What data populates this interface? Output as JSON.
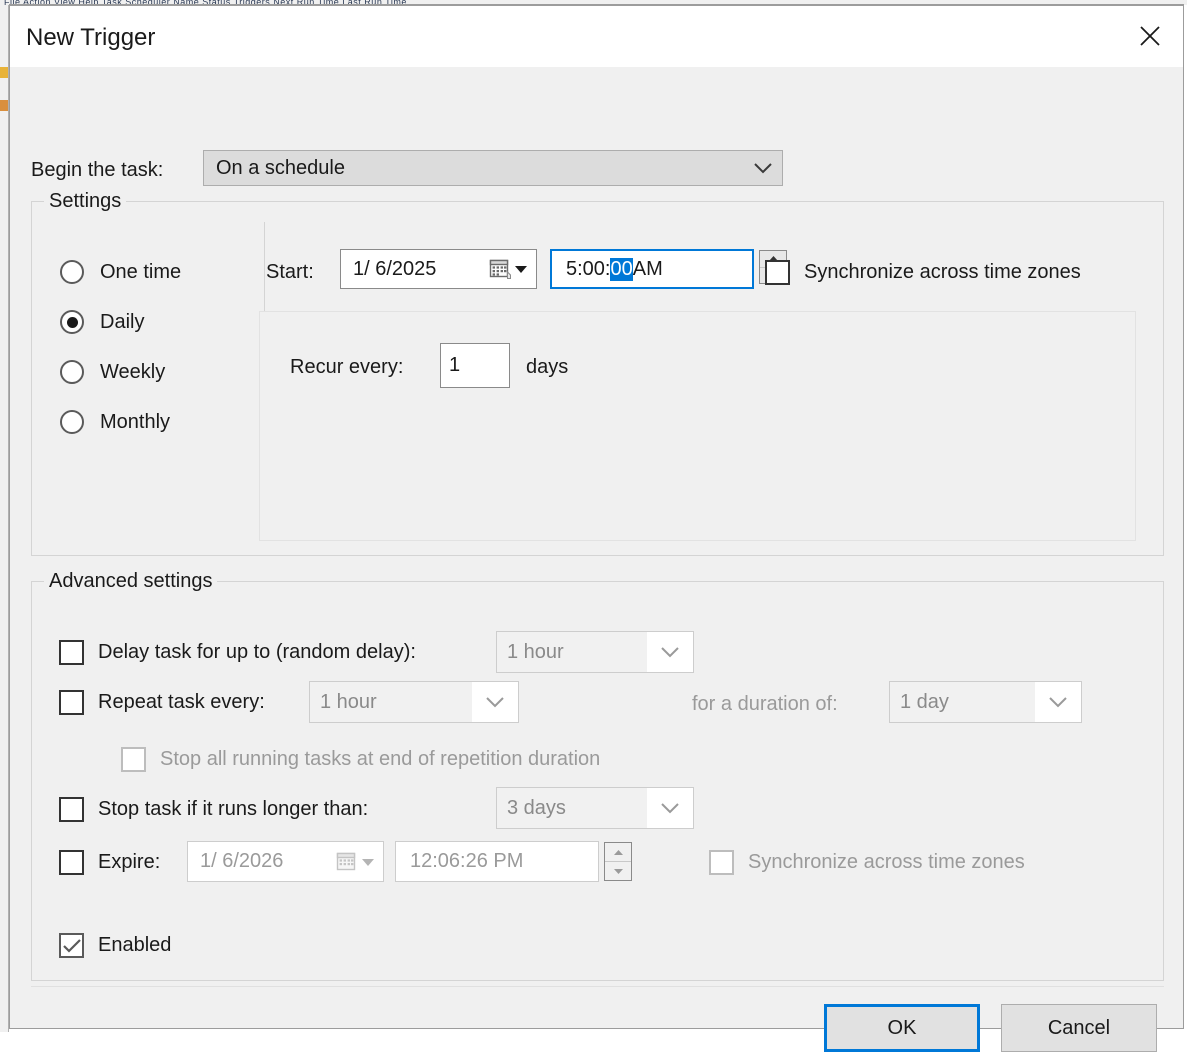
{
  "background": {
    "top_strip_text": "File Action View Help   Task Scheduler   Name Status Triggers Next Run Time Last Run Time"
  },
  "window": {
    "title": "New Trigger",
    "close_icon": "close-icon"
  },
  "begin": {
    "label": "Begin the task:",
    "value": "On a schedule",
    "chevron_icon": "chevron-down-icon"
  },
  "settings": {
    "legend": "Settings",
    "schedule_options": [
      {
        "label": "One time",
        "checked": false
      },
      {
        "label": "Daily",
        "checked": true
      },
      {
        "label": "Weekly",
        "checked": false
      },
      {
        "label": "Monthly",
        "checked": false
      }
    ],
    "start": {
      "label": "Start:",
      "date": "1/  6/2025",
      "calendar_icon": "calendar-icon",
      "dropdown_icon": "triangle-down-icon",
      "time_prefix": "5:00:",
      "time_selected": "00",
      "time_suffix": " AM",
      "spinner_icon": "spinner-up-down-icon"
    },
    "sync_time_zones": {
      "label": "Synchronize across time zones",
      "checked": false,
      "disabled": false
    },
    "recur": {
      "label": "Recur every:",
      "value": "1",
      "unit": "days"
    }
  },
  "advanced": {
    "legend": "Advanced settings",
    "delay_task": {
      "label": "Delay task for up to (random delay):",
      "checked": false,
      "value": "1 hour"
    },
    "repeat_task": {
      "label": "Repeat task every:",
      "checked": false,
      "value": "1 hour",
      "duration_label": "for a duration of:",
      "duration_value": "1 day"
    },
    "stop_all_running": {
      "label": "Stop all running tasks at end of repetition duration",
      "checked": false,
      "disabled": true
    },
    "stop_if_longer": {
      "label": "Stop task if it runs longer than:",
      "checked": false,
      "value": "3 days"
    },
    "expire": {
      "label": "Expire:",
      "checked": false,
      "date": "1/  6/2026",
      "time": "12:06:26 PM",
      "sync_label": "Synchronize across time zones",
      "sync_checked": false
    },
    "enabled": {
      "label": "Enabled",
      "checked": true
    }
  },
  "buttons": {
    "ok": "OK",
    "cancel": "Cancel"
  },
  "colors": {
    "accent": "#0078d7",
    "selection": "#0078d7",
    "dialog_bg": "#f0f0f0",
    "disabled_text": "#9a9a9a"
  }
}
